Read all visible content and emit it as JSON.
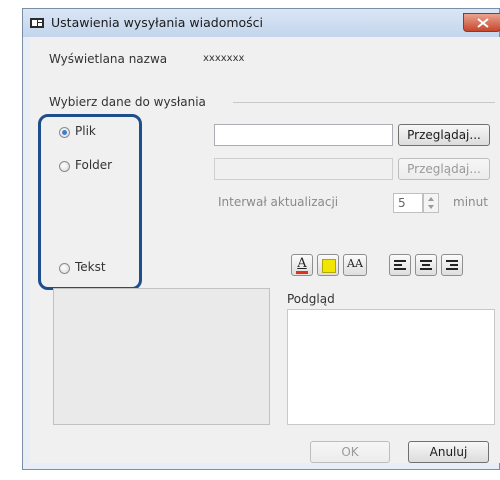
{
  "window": {
    "title": "Ustawienia wysyłania wiadomości"
  },
  "display_name": {
    "label": "Wyświetlana nazwa",
    "value": "xxxxxxx"
  },
  "data_group": {
    "label": "Wybierz dane do wysłania",
    "options": [
      {
        "label": "Plik",
        "checked": true
      },
      {
        "label": "Folder",
        "checked": false
      },
      {
        "label": "Tekst",
        "checked": false
      }
    ]
  },
  "file": {
    "path_value": "",
    "browse_label": "Przeglądaj..."
  },
  "folder": {
    "path_value": "",
    "browse_label": "Przeglądaj..."
  },
  "interval": {
    "label": "Interwał aktualizacji",
    "value": "5",
    "unit": "minut"
  },
  "formatting": {
    "font_color_glyph": "A",
    "font_size_glyph": "AA",
    "colors": {
      "font_color_underline": "#e0301e",
      "background_swatch": "#f2e600"
    }
  },
  "preview": {
    "label": "Podgląd"
  },
  "footer": {
    "ok_label": "OK",
    "cancel_label": "Anuluj"
  }
}
